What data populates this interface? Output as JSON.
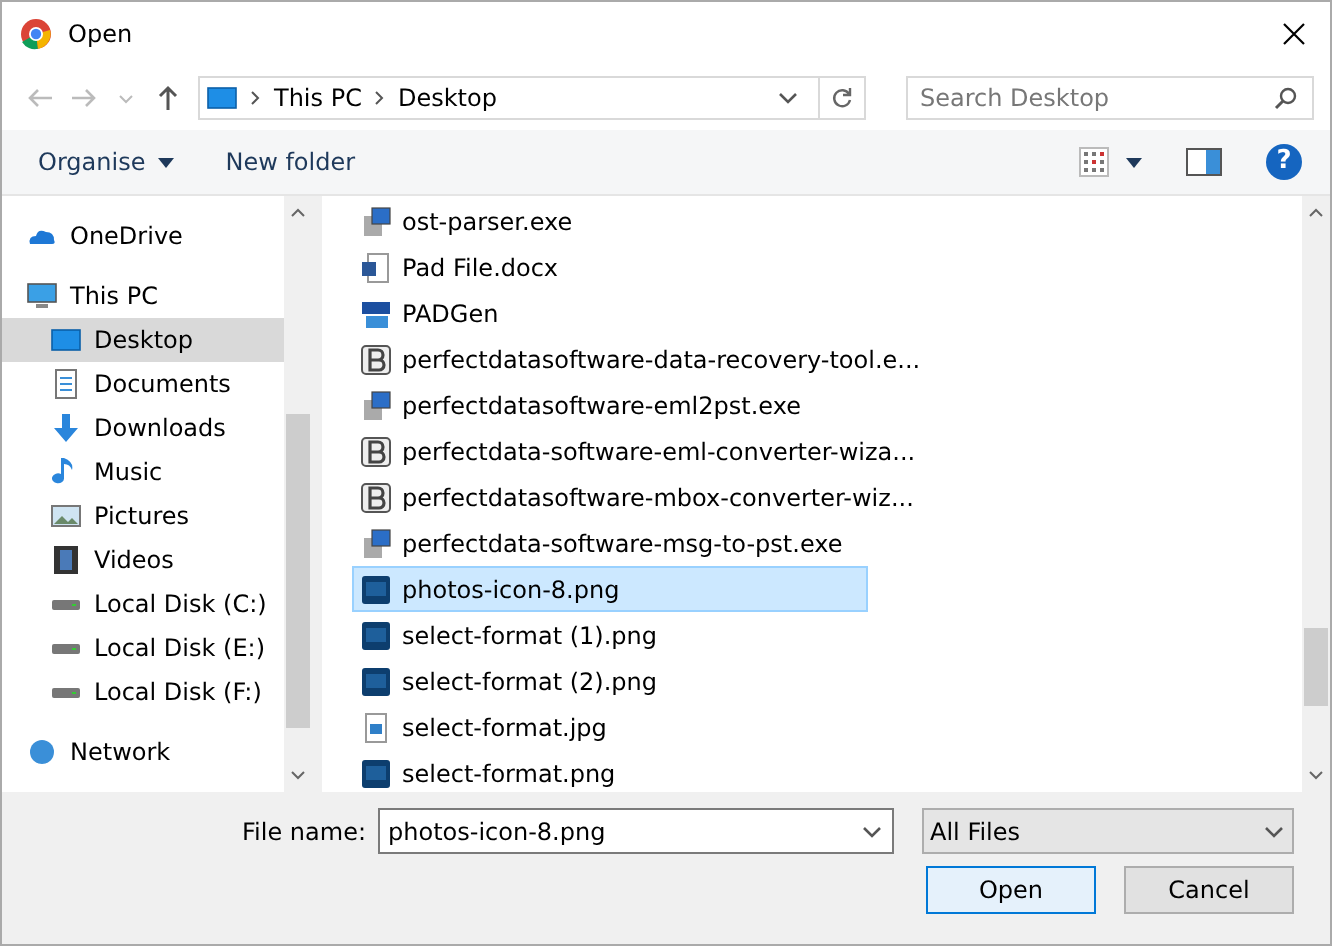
{
  "window": {
    "title": "Open"
  },
  "nav": {
    "path": [
      "This PC",
      "Desktop"
    ],
    "search": {
      "placeholder": "Search Desktop"
    }
  },
  "toolbar": {
    "organise": "Organise",
    "new_folder": "New folder",
    "help": "?"
  },
  "sidebar": {
    "items": [
      {
        "label": "OneDrive",
        "kind": "cloud",
        "selected": false
      },
      {
        "label": "This PC",
        "kind": "pc",
        "selected": false,
        "children": [
          {
            "label": "Desktop",
            "kind": "desktop",
            "selected": true
          },
          {
            "label": "Documents",
            "kind": "documents",
            "selected": false
          },
          {
            "label": "Downloads",
            "kind": "downloads",
            "selected": false
          },
          {
            "label": "Music",
            "kind": "music",
            "selected": false
          },
          {
            "label": "Pictures",
            "kind": "pictures",
            "selected": false
          },
          {
            "label": "Videos",
            "kind": "videos",
            "selected": false
          },
          {
            "label": "Local Disk (C:)",
            "kind": "disk",
            "selected": false
          },
          {
            "label": "Local Disk (E:)",
            "kind": "disk",
            "selected": false
          },
          {
            "label": "Local Disk (F:)",
            "kind": "disk",
            "selected": false
          }
        ]
      },
      {
        "label": "Network",
        "kind": "network",
        "selected": false
      }
    ]
  },
  "files": [
    {
      "name": "ost-parser.exe",
      "kind": "installer",
      "selected": false
    },
    {
      "name": "Pad File.docx",
      "kind": "word",
      "selected": false
    },
    {
      "name": "PADGen",
      "kind": "padgen",
      "selected": false
    },
    {
      "name": "perfectdatasoftware-data-recovery-tool.e...",
      "kind": "generic",
      "selected": false
    },
    {
      "name": "perfectdatasoftware-eml2pst.exe",
      "kind": "installer",
      "selected": false
    },
    {
      "name": "perfectdata-software-eml-converter-wiza...",
      "kind": "generic",
      "selected": false
    },
    {
      "name": "perfectdatasoftware-mbox-converter-wiz...",
      "kind": "generic",
      "selected": false
    },
    {
      "name": "perfectdata-software-msg-to-pst.exe",
      "kind": "installer",
      "selected": false
    },
    {
      "name": "photos-icon-8.png",
      "kind": "ps",
      "selected": true
    },
    {
      "name": "select-format (1).png",
      "kind": "ps",
      "selected": false
    },
    {
      "name": "select-format (2).png",
      "kind": "ps",
      "selected": false
    },
    {
      "name": "select-format.jpg",
      "kind": "image",
      "selected": false
    },
    {
      "name": "select-format.png",
      "kind": "ps",
      "selected": false
    }
  ],
  "footer": {
    "file_name_label": "File name:",
    "file_name": "photos-icon-8.png",
    "filter": "All Files",
    "buttons": [
      "Open",
      "Cancel"
    ]
  }
}
